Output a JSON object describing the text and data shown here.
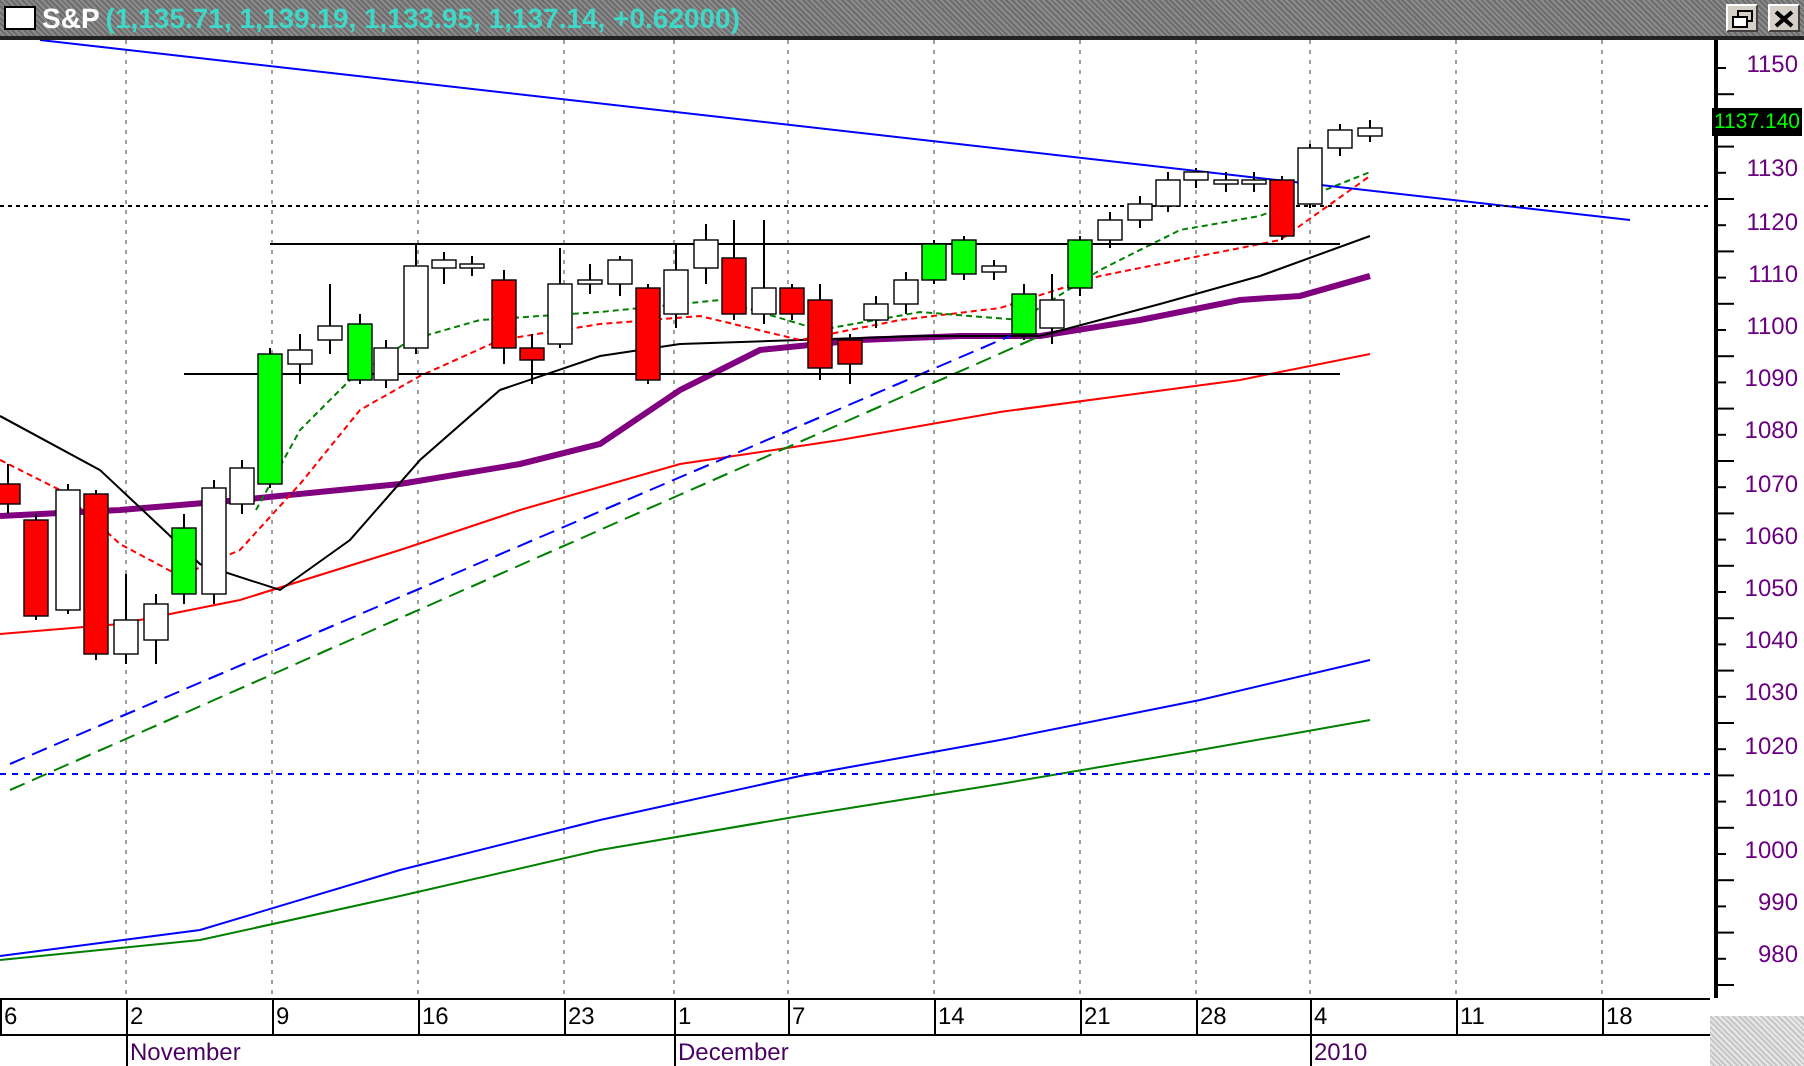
{
  "window": {
    "title": "S&P",
    "quote": "(1,135.71, 1,139.19, 1,133.95, 1,137.14, +0.62000)"
  },
  "price_axis": {
    "labels": [
      "1150",
      "1130",
      "1120",
      "1110",
      "1100",
      "1090",
      "1080",
      "1070",
      "1060",
      "1050",
      "1040",
      "1030",
      "1020",
      "1010",
      "1000",
      "990",
      "980"
    ],
    "last_price": "1137.140"
  },
  "date_axis": {
    "days": [
      "6",
      "2",
      "9",
      "16",
      "23",
      "1",
      "7",
      "14",
      "21",
      "28",
      "4",
      "11",
      "18"
    ],
    "months": [
      "November",
      "December",
      "2010"
    ]
  }
}
